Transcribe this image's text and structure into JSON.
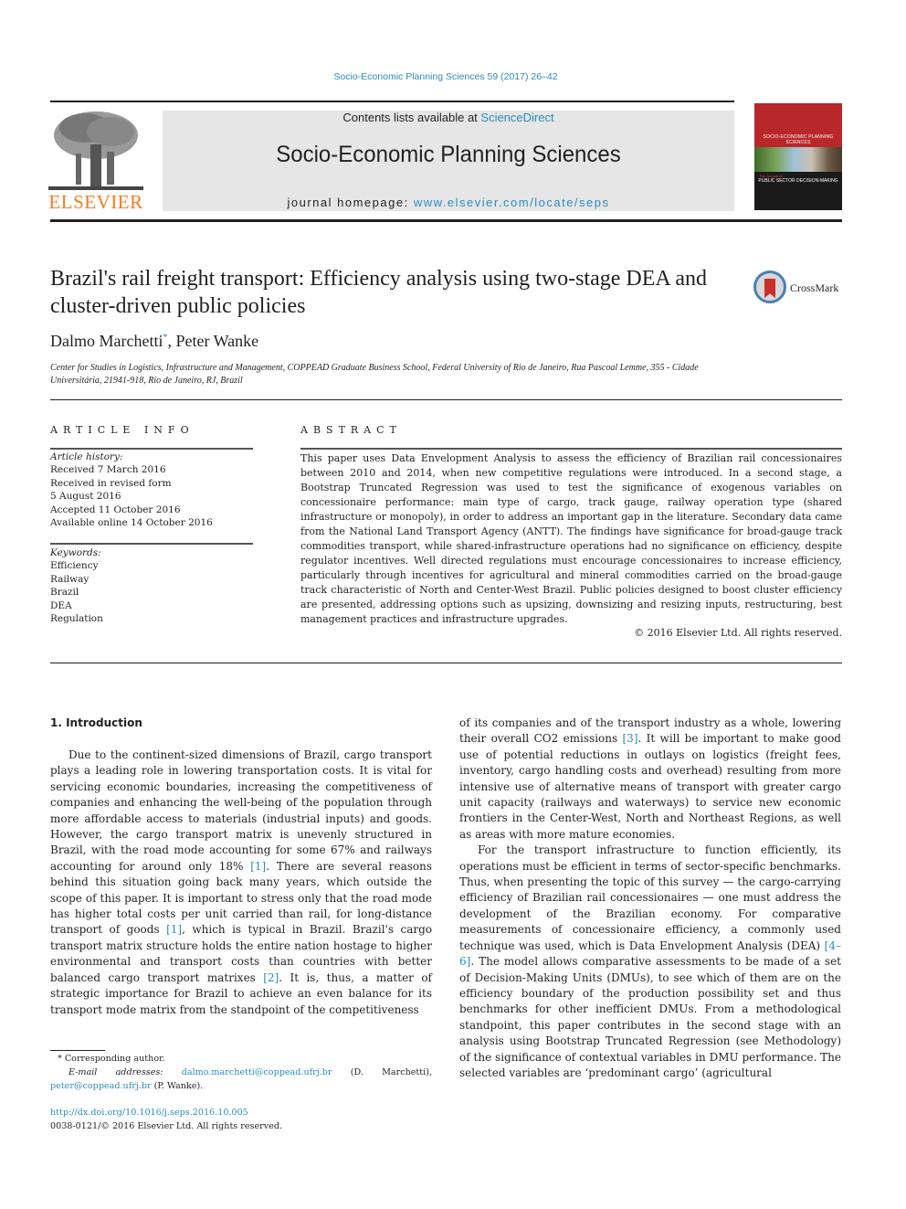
{
  "header": {
    "journal_ref": "Socio-Economic Planning Sciences 59 (2017) 26–42",
    "contents_prefix": "Contents lists available at ",
    "contents_link": "ScienceDirect",
    "journal_title": "Socio-Economic Planning Sciences",
    "homepage_prefix": "journal homepage: ",
    "homepage_link": "www.elsevier.com/locate/seps",
    "publisher_logo_text": "ELSEVIER",
    "cover": {
      "title": "SOCIO-ECONOMIC PLANNING SCIENCES",
      "subtitle_small": "The Journal of",
      "subtitle": "PUBLIC SECTOR DECISION-MAKING"
    }
  },
  "article": {
    "title": "Brazil's rail freight transport: Efficiency analysis using two-stage DEA and cluster-driven public policies",
    "crossmark_label": "CrossMark",
    "authors": [
      {
        "name": "Dalmo Marchetti",
        "mark": "*"
      },
      {
        "name": "Peter Wanke",
        "mark": ""
      }
    ],
    "author_separator": ", ",
    "affiliation": "Center for Studies in Logistics, Infrastructure and Management, COPPEAD Graduate Business School, Federal University of Rio de Janeiro, Rua Pascoal Lemme, 355 - Cidade Universitária, 21941-918, Rio de Janeiro, RJ, Brazil"
  },
  "article_info": {
    "heading": "ARTICLE INFO",
    "history_label": "Article history:",
    "history": [
      "Received 7 March 2016",
      "Received in revised form",
      "5 August 2016",
      "Accepted 11 October 2016",
      "Available online 14 October 2016"
    ],
    "keywords_label": "Keywords:",
    "keywords": [
      "Efficiency",
      "Railway",
      "Brazil",
      "DEA",
      "Regulation"
    ]
  },
  "abstract": {
    "heading": "ABSTRACT",
    "text": "This paper uses Data Envelopment Analysis to assess the efficiency of Brazilian rail concessionaires between 2010 and 2014, when new competitive regulations were introduced. In a second stage, a Bootstrap Truncated Regression was used to test the significance of exogenous variables on concessionaire performance: main type of cargo, track gauge, railway operation type (shared infrastructure or monopoly), in order to address an important gap in the literature. Secondary data came from the National Land Transport Agency (ANTT). The findings have significance for broad-gauge track commodities transport, while shared-infrastructure operations had no significance on efficiency, despite regulator incentives. Well directed regulations must encourage concessionaires to increase efficiency, particularly through incentives for agricultural and mineral commodities carried on the broad-gauge track characteristic of North and Center-West Brazil. Public policies designed to boost cluster efficiency are presented, addressing options such as upsizing, downsizing and resizing inputs, restructuring, best management practices and infrastructure upgrades.",
    "copyright": "© 2016 Elsevier Ltd. All rights reserved."
  },
  "body": {
    "section_heading": "1.  Introduction",
    "left_paragraph": {
      "part1": "Due to the continent-sized dimensions of Brazil, cargo transport plays a leading role in lowering transportation costs. It is vital for servicing economic boundaries, increasing the competitiveness of companies and enhancing the well-being of the population through more affordable access to materials (industrial inputs) and goods. However, the cargo transport matrix is unevenly structured in Brazil, with the road mode accounting for some 67% and railways accounting for around only 18% ",
      "ref1": "[1]",
      "part2": ". There are several reasons behind this situation going back many years, which outside the scope of this paper. It is important to stress only that the road mode has higher total costs per unit carried than rail, for long-distance transport of goods ",
      "ref2": "[1]",
      "part3": ", which is typical in Brazil. Brazil's cargo transport matrix structure holds the entire nation hostage to higher environmental and transport costs than countries with better balanced cargo transport matrixes ",
      "ref3": "[2]",
      "part4": ". It is, thus, a matter of strategic importance for Brazil to achieve an even balance for its transport mode matrix from the standpoint of the competitiveness"
    },
    "right_para1": {
      "part1": "of its companies and of the transport industry as a whole, lowering their overall CO2 emissions ",
      "ref1": "[3]",
      "part2": ". It will be important to make good use of potential reductions in outlays on logistics (freight fees, inventory, cargo handling costs and overhead) resulting from more intensive use of alternative means of transport with greater cargo unit capacity (railways and waterways) to service new economic frontiers in the Center-West, North and Northeast Regions, as well as areas with more mature economies."
    },
    "right_para2": {
      "part1": "For the transport infrastructure to function efficiently, its operations must be efficient in terms of sector-specific benchmarks. Thus, when presenting the topic of this survey — the cargo-carrying efficiency of Brazilian rail concessionaires — one must address the development of the Brazilian economy. For comparative measurements of concessionaire efficiency, a commonly used technique was used, which is Data Envelopment Analysis (DEA) ",
      "ref1": "[4–6]",
      "part2": ". The model allows comparative assessments to be made of a set of Decision-Making Units (DMUs), to see which of them are on the efficiency boundary of the production possibility set and thus benchmarks for other inefficient DMUs. From a methodological standpoint, this paper contributes in the second stage with an analysis using Bootstrap Truncated Regression (see Methodology) of the significance of contextual variables in DMU performance. The selected variables are ‘predominant cargo’ (agricultural"
    }
  },
  "footnotes": {
    "corresponding": "* Corresponding author.",
    "email_label": "E-mail addresses: ",
    "email1": "dalmo.marchetti@coppead.ufrj.br",
    "email1_owner": " (D. Marchetti), ",
    "email2": "peter@coppead.ufrj.br",
    "email2_owner": " (P. Wanke).",
    "doi": "http://dx.doi.org/10.1016/j.seps.2016.10.005",
    "issn_copyright": "0038-0121/© 2016 Elsevier Ltd. All rights reserved."
  }
}
